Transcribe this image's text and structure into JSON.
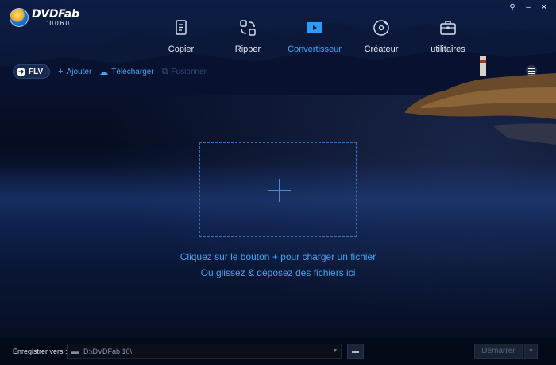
{
  "app": {
    "name": "DVDFab",
    "version": "10.0.6.0"
  },
  "window_controls": [
    {
      "name": "pin-icon",
      "glyph": "⚲"
    },
    {
      "name": "minimize-icon",
      "glyph": "–"
    },
    {
      "name": "close-icon",
      "glyph": "✕"
    }
  ],
  "nav": {
    "items": [
      {
        "label": "Copier",
        "icon": "copy-icon"
      },
      {
        "label": "Ripper",
        "icon": "ripper-icon"
      },
      {
        "label": "Convertisseur",
        "icon": "converter-icon",
        "active": true
      },
      {
        "label": "Créateur",
        "icon": "creator-icon"
      },
      {
        "label": "utilitaires",
        "icon": "utilities-icon"
      }
    ],
    "active_color": "#3aa7ff"
  },
  "toolbar": {
    "profile_label": "FLV",
    "add_label": "Ajouter",
    "download_label": "Télécharger",
    "merge_label": "Fusionner"
  },
  "dropzone": {
    "hint_line1": "Cliquez sur le bouton + pour charger un fichier",
    "hint_line2": "Ou glissez & déposez des fichiers ici"
  },
  "bottom": {
    "save_label": "Enregistrer vers :",
    "path_value": "D:\\DVDFab 10\\",
    "start_label": "Démarrer"
  }
}
